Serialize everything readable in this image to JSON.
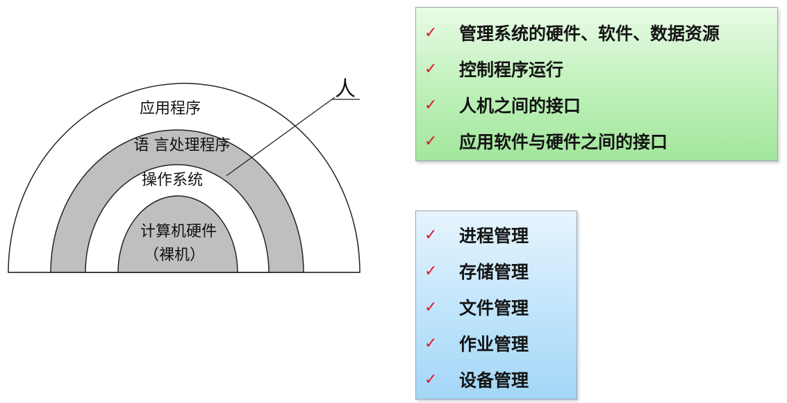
{
  "diagram": {
    "layers": {
      "outer": "应用程序",
      "second": "语 言处理程序",
      "third": "操作系统",
      "core_line1": "计算机硬件",
      "core_line2": "（裸机）"
    },
    "person_label": "人",
    "colors": {
      "ring_gray": "#bfbfbf",
      "ring_white": "#ffffff",
      "stroke": "#222222"
    }
  },
  "functions_box": {
    "items": [
      "管理系统的硬件、软件、数据资源",
      "控制程序运行",
      "人机之间的接口",
      "应用软件与硬件之间的接口"
    ],
    "check_glyph": "✓"
  },
  "management_box": {
    "items": [
      "进程管理",
      "存储管理",
      "文件管理",
      "作业管理",
      "设备管理"
    ],
    "check_glyph": "✓"
  }
}
